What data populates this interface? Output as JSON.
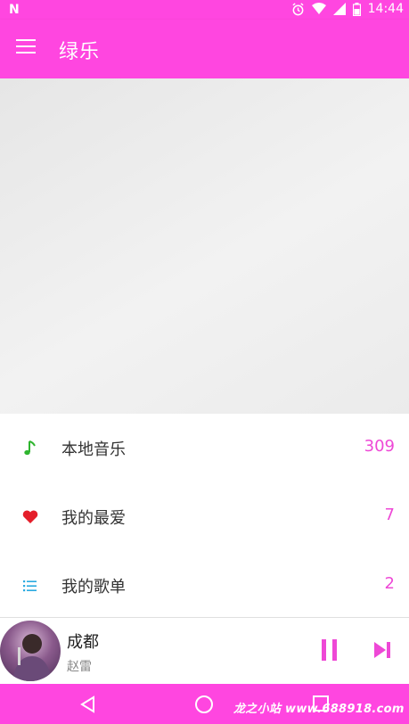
{
  "status_bar": {
    "left_icon": "N",
    "time": "14:44",
    "icons": [
      "alarm-icon",
      "wifi-icon",
      "signal-icon",
      "battery-icon"
    ]
  },
  "app_bar": {
    "title": "绿乐",
    "menu_icon": "hamburger-menu-icon"
  },
  "list": [
    {
      "icon": "music-note-icon",
      "label": "本地音乐",
      "count": "309",
      "icon_color": "#2fb52f"
    },
    {
      "icon": "heart-icon",
      "label": "我的最爱",
      "count": "7",
      "icon_color": "#e41e2a"
    },
    {
      "icon": "playlist-icon",
      "label": "我的歌单",
      "count": "2",
      "icon_color": "#29a9e0"
    }
  ],
  "player": {
    "title": "成都",
    "artist": "赵雷",
    "pause_icon": "pause-icon",
    "next_icon": "skip-next-icon"
  },
  "nav_bar": {
    "icons": [
      "back-icon",
      "home-icon",
      "recents-icon"
    ]
  },
  "watermark": "龙之小站 www.688918.com",
  "colors": {
    "accent": "#ff46e0",
    "count_text": "#ee48d6"
  }
}
